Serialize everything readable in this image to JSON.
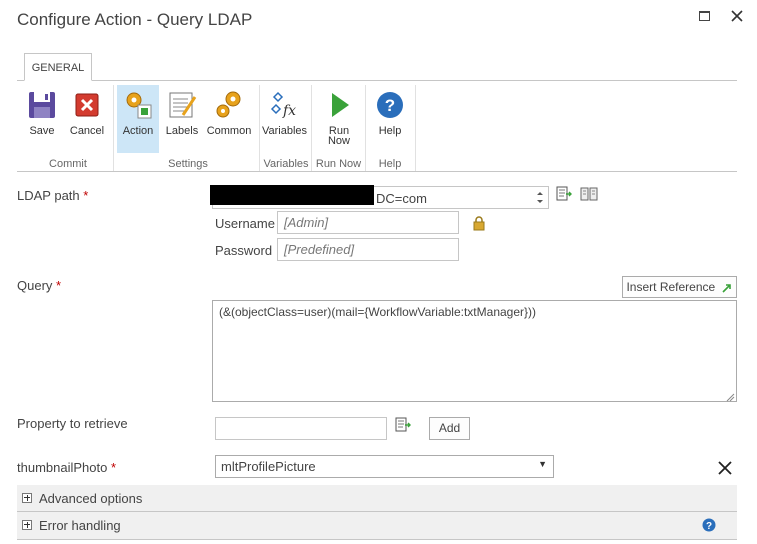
{
  "dialog": {
    "title": "Configure Action - Query LDAP"
  },
  "ribbon": {
    "tab": "GENERAL",
    "buttons": {
      "save": "Save",
      "cancel": "Cancel",
      "action": "Action",
      "labels": "Labels",
      "common": "Common",
      "variables": "Variables",
      "run_now_line1": "Run",
      "run_now_line2": "Now",
      "help": "Help"
    },
    "groups": {
      "commit": "Commit",
      "settings": "Settings",
      "variables": "Variables",
      "run_now": "Run Now",
      "help": "Help"
    }
  },
  "form": {
    "ldap_path": {
      "label": "LDAP path",
      "required": "*",
      "value_visible": "DC=com"
    },
    "username": {
      "label": "Username",
      "value": "[Admin]"
    },
    "password": {
      "label": "Password",
      "value": "[Predefined]"
    },
    "query": {
      "label": "Query",
      "required": "*",
      "insert_reference": "Insert Reference",
      "value": "(&(objectClass=user)(mail={WorkflowVariable:txtManager}))"
    },
    "property": {
      "label": "Property to retrieve",
      "value": "",
      "add_button": "Add"
    },
    "thumbnail": {
      "label": "thumbnailPhoto",
      "required": "*",
      "selected": "mltProfilePicture"
    }
  },
  "sections": {
    "advanced": "Advanced options",
    "error_handling": "Error handling"
  },
  "icons": {
    "maximize": "maximize-icon",
    "close": "close-icon",
    "lock": "lock-icon",
    "help": "help-icon"
  },
  "colors": {
    "accent_active": "#cde6f7",
    "required": "#bf0000",
    "help_blue": "#2a6ebb",
    "run_green": "#3aa23a"
  }
}
